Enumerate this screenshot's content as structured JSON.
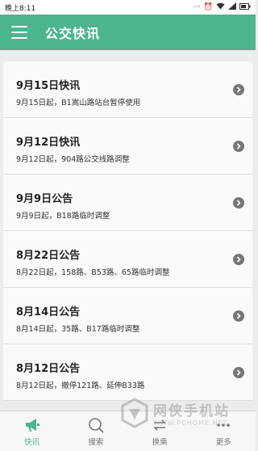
{
  "status_bar": {
    "time": "晚上8:11"
  },
  "app_bar": {
    "title": "公交快讯"
  },
  "items": [
    {
      "title": "9月15日快讯",
      "subtitle": "9月15日起，B1嵩山路站台暂停使用"
    },
    {
      "title": "9月12日快讯",
      "subtitle": "9月12日起，904路公交线路调整"
    },
    {
      "title": "9月9日公告",
      "subtitle": "9月9日起，B18路临时调整"
    },
    {
      "title": "8月22日公告",
      "subtitle": "8月22日起，158路、B53路、65路临时调整"
    },
    {
      "title": "8月14日公告",
      "subtitle": "8月14日起，35路、B17路临时调整"
    },
    {
      "title": "8月12日公告",
      "subtitle": "8月12日起，撤停121路、延伸B33路"
    }
  ],
  "tabs": [
    {
      "label": "快讯",
      "icon": "megaphone-icon",
      "active": true
    },
    {
      "label": "搜索",
      "icon": "search-icon",
      "active": false
    },
    {
      "label": "换乘",
      "icon": "transfer-icon",
      "active": false
    },
    {
      "label": "更多",
      "icon": "more-icon",
      "active": false
    }
  ],
  "watermark": {
    "text": "网侠手机站",
    "sub": "WWW.PCHOME.NET"
  },
  "colors": {
    "accent": "#4bb58e",
    "chevron": "#777777"
  }
}
